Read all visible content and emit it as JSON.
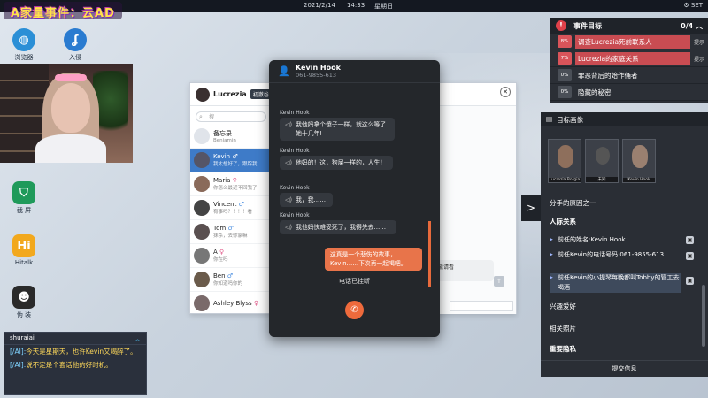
{
  "topbar": {
    "date": "2021/2/14",
    "time": "14:33",
    "weekday": "星期日",
    "settings": "SET"
  },
  "stream_title": "A家量事件：云AD",
  "desktop_icons": [
    {
      "label": "浏览器"
    },
    {
      "label": "入侵"
    },
    {
      "label": "截 屏"
    },
    {
      "label": "Hitalk"
    },
    {
      "label": "伪 装"
    }
  ],
  "chat": {
    "user": "shuraiai",
    "lines": [
      {
        "who": "[/AI]:",
        "text": "今天是星期天，也许Kevin又喝醉了。"
      },
      {
        "who": "[/AI]:",
        "text": "说不定是个套话他的好时机。"
      }
    ]
  },
  "messenger": {
    "owner": "Lucrezia",
    "tag": "初澈谷号",
    "search_placeholder": "搜",
    "contacts": [
      {
        "name": "备忘录",
        "status": "Benjamin",
        "gender": ""
      },
      {
        "name": "Kevin",
        "status": "我太想好了，跟踪我",
        "gender": "♂"
      },
      {
        "name": "Maria",
        "status": "你怎么最近不回我了",
        "gender": "♀"
      },
      {
        "name": "Vincent",
        "status": "有事吗？！！！看",
        "gender": "♂"
      },
      {
        "name": "Tom",
        "status": "抹杀，去你家嘛",
        "gender": "♂"
      },
      {
        "name": "A",
        "status": "你在吗",
        "gender": "♀"
      },
      {
        "name": "Ben",
        "status": "你知道吗你的",
        "gender": "♂"
      },
      {
        "name": "Ashley Blyss",
        "status": "",
        "gender": "♀"
      }
    ],
    "right_bubble": "来你能请看",
    "scroll_icon": "↑"
  },
  "call": {
    "name": "Kevin Hook",
    "number": "061-9855-613",
    "messages": [
      {
        "from": "Kevin Hook",
        "text": "我他妈拿个傻子一样，就这么等了她十几年!"
      },
      {
        "from": "Kevin Hook",
        "text": "他妈的！这，狗屎一样的，人生！"
      },
      {
        "from": "Kevin Hook",
        "text": "我，我……"
      },
      {
        "from": "Kevin Hook",
        "text": "我他妈快难受死了，我得先去……"
      }
    ],
    "outgoing": "这真是一个悲伤的故事，Kevin……下次再一起喝吧。",
    "ended": "电话已挂断",
    "hangup_icon": "phone-hangup"
  },
  "events": {
    "title": "事件目标",
    "progress": "0/4",
    "items": [
      {
        "pct": "8%",
        "text": "调查Lucrezia死前联系人",
        "tip": "提示",
        "hot": true
      },
      {
        "pct": "7%",
        "text": "Lucrezia的家庭关系",
        "tip": "提示",
        "hot": true
      },
      {
        "pct": "0%",
        "text": "罪恶背后的始作俑者",
        "tip": "",
        "hot": false
      },
      {
        "pct": "0%",
        "text": "隐藏的秘密",
        "tip": "",
        "hot": false
      }
    ]
  },
  "target": {
    "title": "目标画像",
    "portraits": [
      {
        "caption": "Lucrezia Borgia"
      },
      {
        "caption": "未知"
      },
      {
        "caption": "Kevin Hook"
      }
    ],
    "partial_text": "分手的原因之一",
    "section_relations": "人际关系",
    "items": [
      {
        "text": "前任的姓名:Kevin Hook",
        "selected": false
      },
      {
        "text": "前任Kevin的电话号码:061-9855-613",
        "selected": false
      },
      {
        "text": "前任Kevin的小提琴每晚都叫Tobby的管工去喝酒",
        "selected": true
      }
    ],
    "section_hobbies": "兴趣爱好",
    "section_photos": "相关照片",
    "section_secret": "重要隐私",
    "footer": "提交信息"
  },
  "colors": {
    "accent": "#e8744a",
    "alert": "#d9545a",
    "active_contact": "#3e7bc8"
  }
}
